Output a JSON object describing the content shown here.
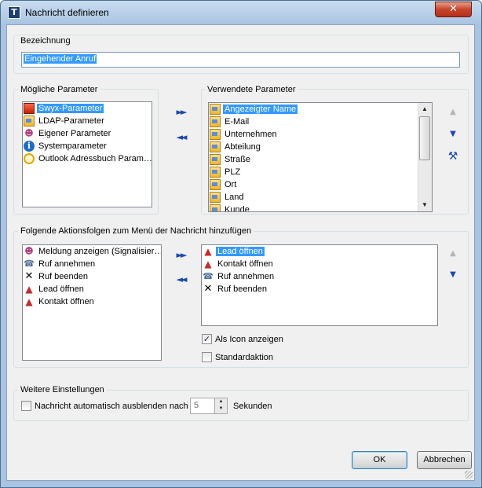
{
  "window": {
    "title": "Nachricht definieren",
    "close_symbol": "✕"
  },
  "bezeichnung": {
    "label": "Bezeichnung",
    "value": "Eingehender Anruf"
  },
  "moegliche_parameter": {
    "label": "Mögliche Parameter",
    "items": [
      {
        "label": "Swyx-Parameter",
        "icon": "swyx-icon",
        "selected": true
      },
      {
        "label": "LDAP-Parameter",
        "icon": "document-icon",
        "selected": false
      },
      {
        "label": "Eigener Parameter",
        "icon": "people-icon",
        "selected": false
      },
      {
        "label": "Systemparameter",
        "icon": "info-icon",
        "selected": false
      },
      {
        "label": "Outlook Adressbuch Param…",
        "icon": "clock-icon",
        "selected": false
      }
    ]
  },
  "verwendete_parameter": {
    "label": "Verwendete Parameter",
    "items": [
      {
        "label": "Angezeigter Name",
        "selected": true
      },
      {
        "label": "E-Mail",
        "selected": false
      },
      {
        "label": "Unternehmen",
        "selected": false
      },
      {
        "label": "Abteilung",
        "selected": false
      },
      {
        "label": "Straße",
        "selected": false
      },
      {
        "label": "PLZ",
        "selected": false
      },
      {
        "label": "Ort",
        "selected": false
      },
      {
        "label": "Land",
        "selected": false
      },
      {
        "label": "Kunde",
        "selected": false
      }
    ]
  },
  "aktionsfolgen": {
    "label": "Folgende Aktionsfolgen zum Menü der Nachricht hinzufügen",
    "available": [
      {
        "label": "Meldung anzeigen (Signalisier…",
        "icon": "people-icon"
      },
      {
        "label": "Ruf annehmen",
        "icon": "phone-icon"
      },
      {
        "label": "Ruf beenden",
        "icon": "x-icon"
      },
      {
        "label": "Lead öffnen",
        "icon": "lead-icon"
      },
      {
        "label": "Kontakt öffnen",
        "icon": "lead-icon"
      }
    ],
    "selected_list": [
      {
        "label": "Lead öffnen",
        "icon": "lead-icon",
        "selected": true
      },
      {
        "label": "Kontakt öffnen",
        "icon": "lead-icon",
        "selected": false
      },
      {
        "label": "Ruf annehmen",
        "icon": "phone-icon",
        "selected": false
      },
      {
        "label": "Ruf beenden",
        "icon": "x-icon",
        "selected": false
      }
    ],
    "als_icon_label": "Als Icon anzeigen",
    "als_icon_checked": true,
    "standardaktion_label": "Standardaktion",
    "standardaktion_checked": false
  },
  "weitere": {
    "label": "Weitere Einstellungen",
    "auto_hide_label": "Nachricht automatisch ausblenden nach",
    "auto_hide_checked": false,
    "seconds_value": "5",
    "seconds_unit": "Sekunden"
  },
  "buttons": {
    "ok": "OK",
    "cancel": "Abbrechen"
  },
  "symbols": {
    "move_right": "►►",
    "move_left": "◄◄",
    "up": "▲",
    "down": "▼",
    "check": "✓",
    "tools": "⚒"
  },
  "colors": {
    "selection": "#3399ff",
    "arrow_blue": "#1a48b4",
    "title_gradient": "#a9c4e2"
  }
}
